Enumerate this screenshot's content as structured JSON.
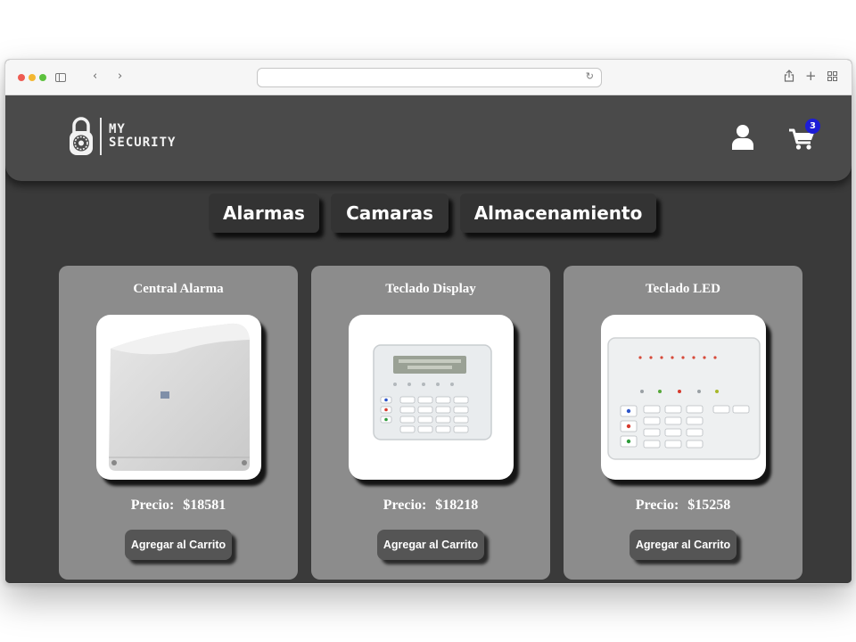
{
  "header": {
    "logo_line1": "MY",
    "logo_line2": "SECURITY",
    "cart_count": "3"
  },
  "categories": [
    "Alarmas",
    "Camaras",
    "Almacenamiento"
  ],
  "products": [
    {
      "title": "Central Alarma",
      "price_label": "Precio:",
      "price": "$18581",
      "button": "Agregar al Carrito",
      "image": "alarm-central-box"
    },
    {
      "title": "Teclado Display",
      "price_label": "Precio:",
      "price": "$18218",
      "button": "Agregar al Carrito",
      "image": "keypad-lcd-display"
    },
    {
      "title": "Teclado LED",
      "price_label": "Precio:",
      "price": "$15258",
      "button": "Agregar al Carrito",
      "image": "keypad-led"
    }
  ],
  "colors": {
    "page_bg": "#3a3a3a",
    "header_bg": "#4a4a4a",
    "card_bg": "#8c8c8c",
    "button_bg": "#555555",
    "badge": "#1d1dd6"
  },
  "icons": [
    "lock-logo-icon",
    "user-icon",
    "cart-icon",
    "sidebar-toggle-icon",
    "back-icon",
    "forward-icon",
    "reload-icon",
    "share-icon",
    "new-tab-icon",
    "tab-overview-icon"
  ]
}
